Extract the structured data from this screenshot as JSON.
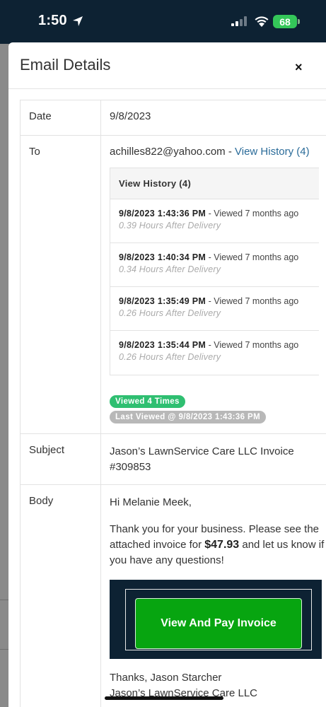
{
  "status_bar": {
    "time": "1:50",
    "battery": "68"
  },
  "modal": {
    "title": "Email Details",
    "close_label": "×"
  },
  "details": {
    "date_label": "Date",
    "date_value": "9/8/2023",
    "to_label": "To",
    "to_email": "achilles822@yahoo.com",
    "to_separator": " - ",
    "view_history_link": "View History (4)",
    "history_header": "View History (4)",
    "history": [
      {
        "time": "9/8/2023 1:43:36 PM",
        "viewed": " - Viewed 7 months ago",
        "after": "0.39 Hours After Delivery"
      },
      {
        "time": "9/8/2023 1:40:34 PM",
        "viewed": " - Viewed 7 months ago",
        "after": "0.34 Hours After Delivery"
      },
      {
        "time": "9/8/2023 1:35:49 PM",
        "viewed": " - Viewed 7 months ago",
        "after": "0.26 Hours After Delivery"
      },
      {
        "time": "9/8/2023 1:35:44 PM",
        "viewed": " - Viewed 7 months ago",
        "after": "0.26 Hours After Delivery"
      }
    ],
    "badge_viewed": "Viewed 4 Times",
    "badge_last": "Last Viewed @ 9/8/2023 1:43:36 PM",
    "subject_label": "Subject",
    "subject_value": "Jason’s LawnService Care LLC Invoice #309853",
    "body_label": "Body",
    "body": {
      "greeting": "Hi Melanie Meek,",
      "text_before": "Thank you for your business. Please see the attached invoice for ",
      "amount": "$47.93",
      "text_after": " and let us know if you have any questions!",
      "pay_button": "View And Pay Invoice",
      "thanks": "Thanks, Jason Starcher",
      "company": "Jason’s LawnService Care LLC"
    }
  }
}
